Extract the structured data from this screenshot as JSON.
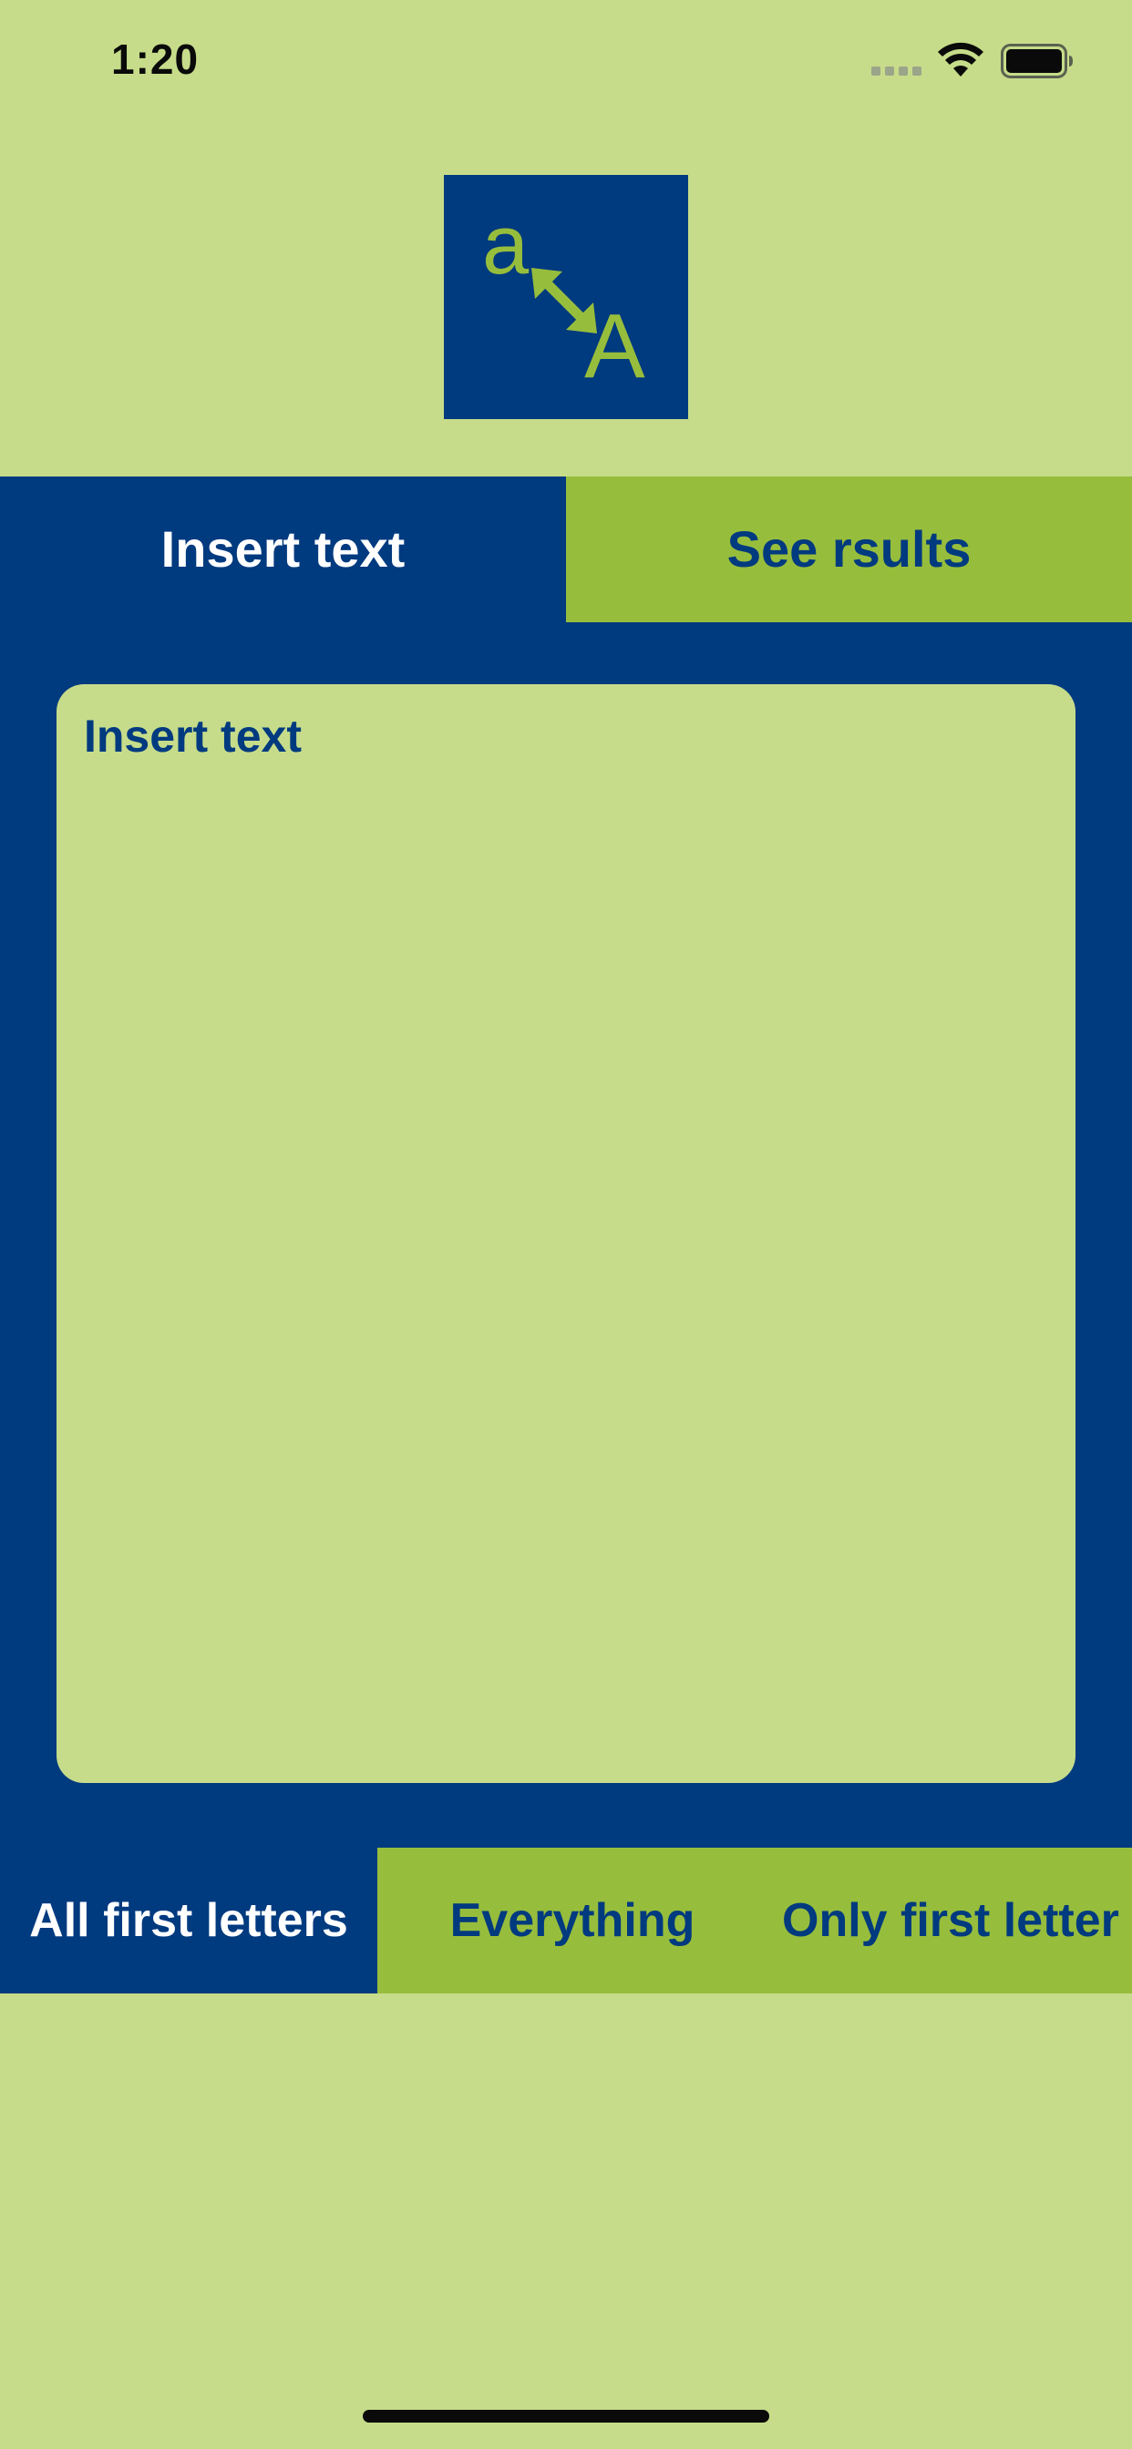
{
  "status_bar": {
    "time": "1:20",
    "icons": [
      "signal-icon",
      "wifi-icon",
      "battery-icon"
    ]
  },
  "logo": {
    "lower": "a",
    "upper": "A",
    "icon": "resize-arrow-icon"
  },
  "top_tabs": [
    {
      "label": "Insert text",
      "active": true
    },
    {
      "label": "See rsults",
      "active": false
    }
  ],
  "input": {
    "placeholder": "Insert text",
    "value": ""
  },
  "mode_tabs": [
    {
      "label": "All first letters",
      "active": true
    },
    {
      "label": "Everything",
      "active": false
    },
    {
      "label": "Only first letter",
      "active": false
    }
  ],
  "colors": {
    "background": "#c6dc8a",
    "primary_blue": "#003a7f",
    "accent_green": "#97bd3c",
    "text_white": "#ffffff"
  }
}
